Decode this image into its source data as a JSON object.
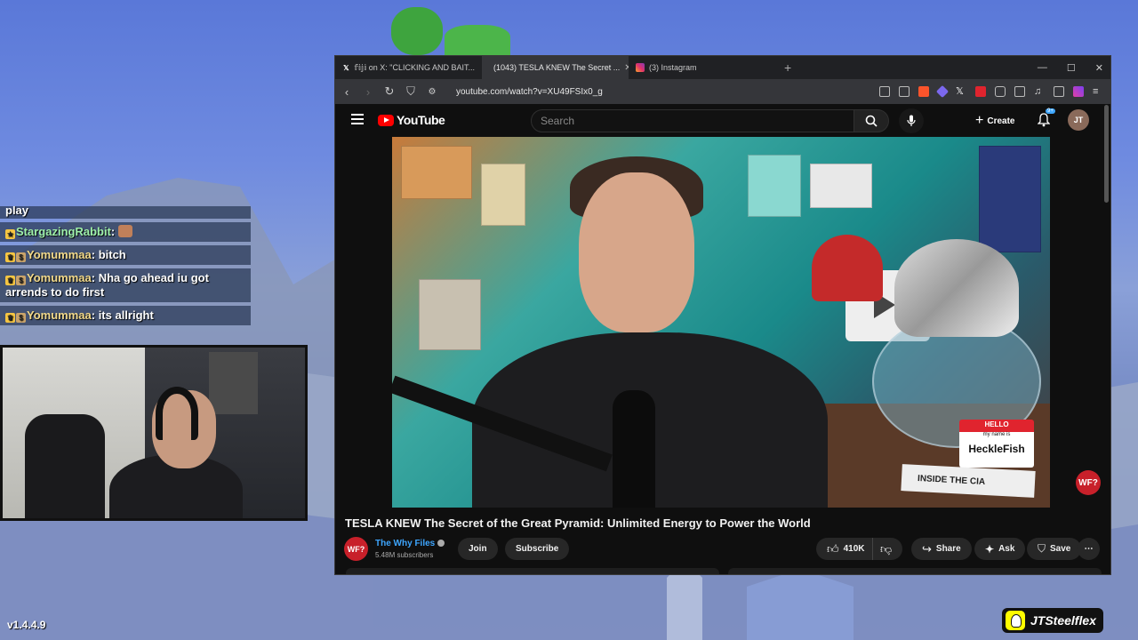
{
  "colors": {
    "youtube_red": "#ff0000",
    "link_blue": "#3ea6ff",
    "browser_dark": "#0f0f0f",
    "tab_bar": "#202124"
  },
  "stream": {
    "version": "v1.4.4.9",
    "snapchat_handle": "JTSteelflex"
  },
  "chat": {
    "partial_line": "play",
    "messages": [
      {
        "user": "StargazingRabbit",
        "text": "",
        "emote": "bear-face-emote"
      },
      {
        "user": "Yomummaa",
        "text": "bitch"
      },
      {
        "user": "Yomummaa",
        "text": "Nha go ahead iu got arrends to do first"
      },
      {
        "user": "Yomummaa",
        "text": "its allright"
      }
    ]
  },
  "browser": {
    "tabs": [
      {
        "label": "𝕗𝕚𝕛𝕚 on X: \"CLICKING AND BAIT...",
        "icon": "x-icon"
      },
      {
        "label": "(1043) TESLA KNEW The Secret ...",
        "icon": "youtube-icon"
      },
      {
        "label": "(3) Instagram",
        "icon": "instagram-icon"
      }
    ],
    "new_tab": "+",
    "url": "youtube.com/watch?v=XU49FSIx0_g"
  },
  "youtube": {
    "logo": "YouTube",
    "search_placeholder": "Search",
    "create_label": "Create",
    "notification_count": "9+",
    "user_initials": "JT",
    "video_title": "TESLA KNEW The Secret of the Great Pyramid: Unlimited Energy to Power the World",
    "channel_name": "The Why Files",
    "channel_avatar": "WF?",
    "subscribers": "5.48M subscribers",
    "join_label": "Join",
    "subscribe_label": "Subscribe",
    "likes": "410K",
    "share_label": "Share",
    "ask_label": "Ask",
    "save_label": "Save",
    "watermark": "WF?",
    "video_overlay": {
      "name_tag_top": "HELLO",
      "name_tag_sub": "my name is",
      "name_tag_name": "HeckleFish",
      "book_title": "INSIDE THE CIA"
    }
  }
}
